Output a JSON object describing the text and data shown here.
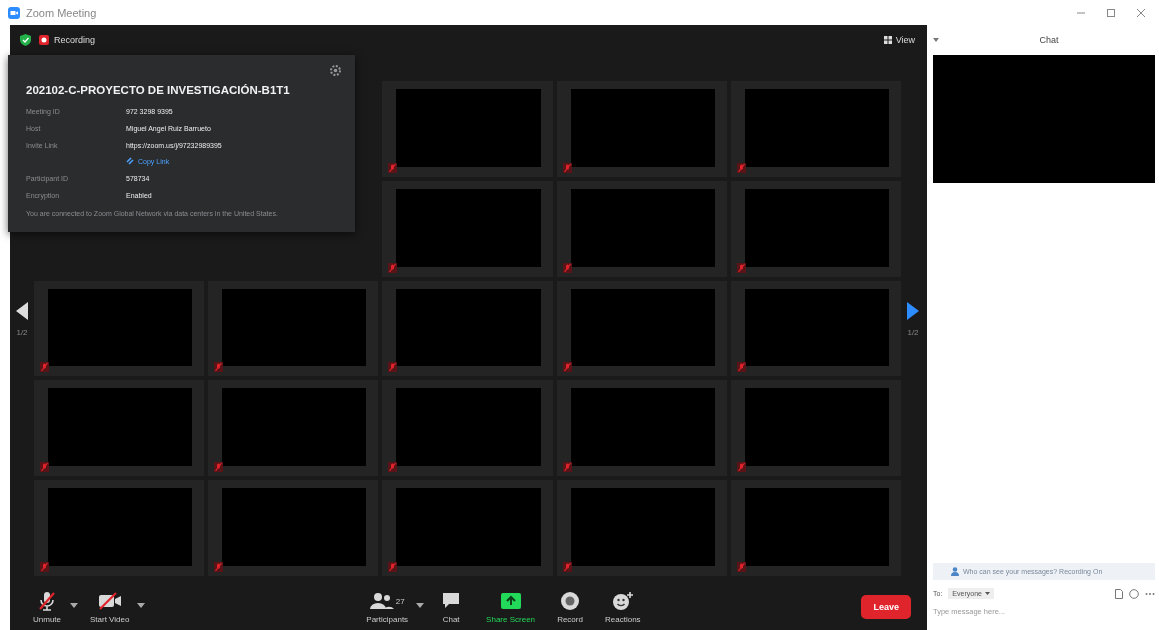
{
  "window": {
    "title": "Zoom Meeting"
  },
  "top_bar": {
    "recording_label": "Recording",
    "view_label": "View"
  },
  "info_popup": {
    "title": "202102-C-PROYECTO DE INVESTIGACIÓN-B1T1",
    "rows": [
      {
        "label": "Meeting ID",
        "value": "972 3298 9395"
      },
      {
        "label": "Host",
        "value": "Miguel Angel Ruiz Barrueto"
      },
      {
        "label": "Invite Link",
        "value": "https://zoom.us/j/97232989395",
        "action": "Copy Link"
      },
      {
        "label": "Participant ID",
        "value": "578734"
      },
      {
        "label": "Encryption",
        "value": "Enabled"
      }
    ],
    "note": "You are connected to Zoom Global Network via data centers in the United States."
  },
  "gallery": {
    "page_left": "1/2",
    "page_right": "1/2",
    "tiles": [
      {
        "muted": true
      },
      {
        "muted": true
      },
      {
        "muted": true
      },
      {
        "muted": true
      },
      {
        "muted": true
      },
      {
        "muted": true
      },
      {
        "muted": true
      },
      {
        "muted": true
      },
      {
        "muted": true
      },
      {
        "muted": true
      },
      {
        "muted": true
      },
      {
        "muted": true
      },
      {
        "muted": true
      },
      {
        "muted": true
      },
      {
        "muted": true
      },
      {
        "muted": true
      },
      {
        "muted": true
      },
      {
        "muted": true
      },
      {
        "muted": true
      },
      {
        "muted": true
      },
      {
        "muted": true
      }
    ]
  },
  "toolbar": {
    "left": [
      {
        "kind": "mic",
        "label": "Unmute"
      },
      {
        "kind": "video",
        "label": "Start Video"
      }
    ],
    "center": [
      {
        "kind": "participants",
        "label": "Participants",
        "count": "27"
      },
      {
        "kind": "chat",
        "label": "Chat"
      },
      {
        "kind": "share",
        "label": "Share Screen"
      },
      {
        "kind": "record",
        "label": "Record"
      },
      {
        "kind": "reactions",
        "label": "Reactions"
      }
    ],
    "leave": "Leave"
  },
  "chat": {
    "title": "Chat",
    "notice": "Who can see your messages? Recording On",
    "to_label": "To:",
    "recipient": "Everyone",
    "placeholder": "Type message here..."
  }
}
